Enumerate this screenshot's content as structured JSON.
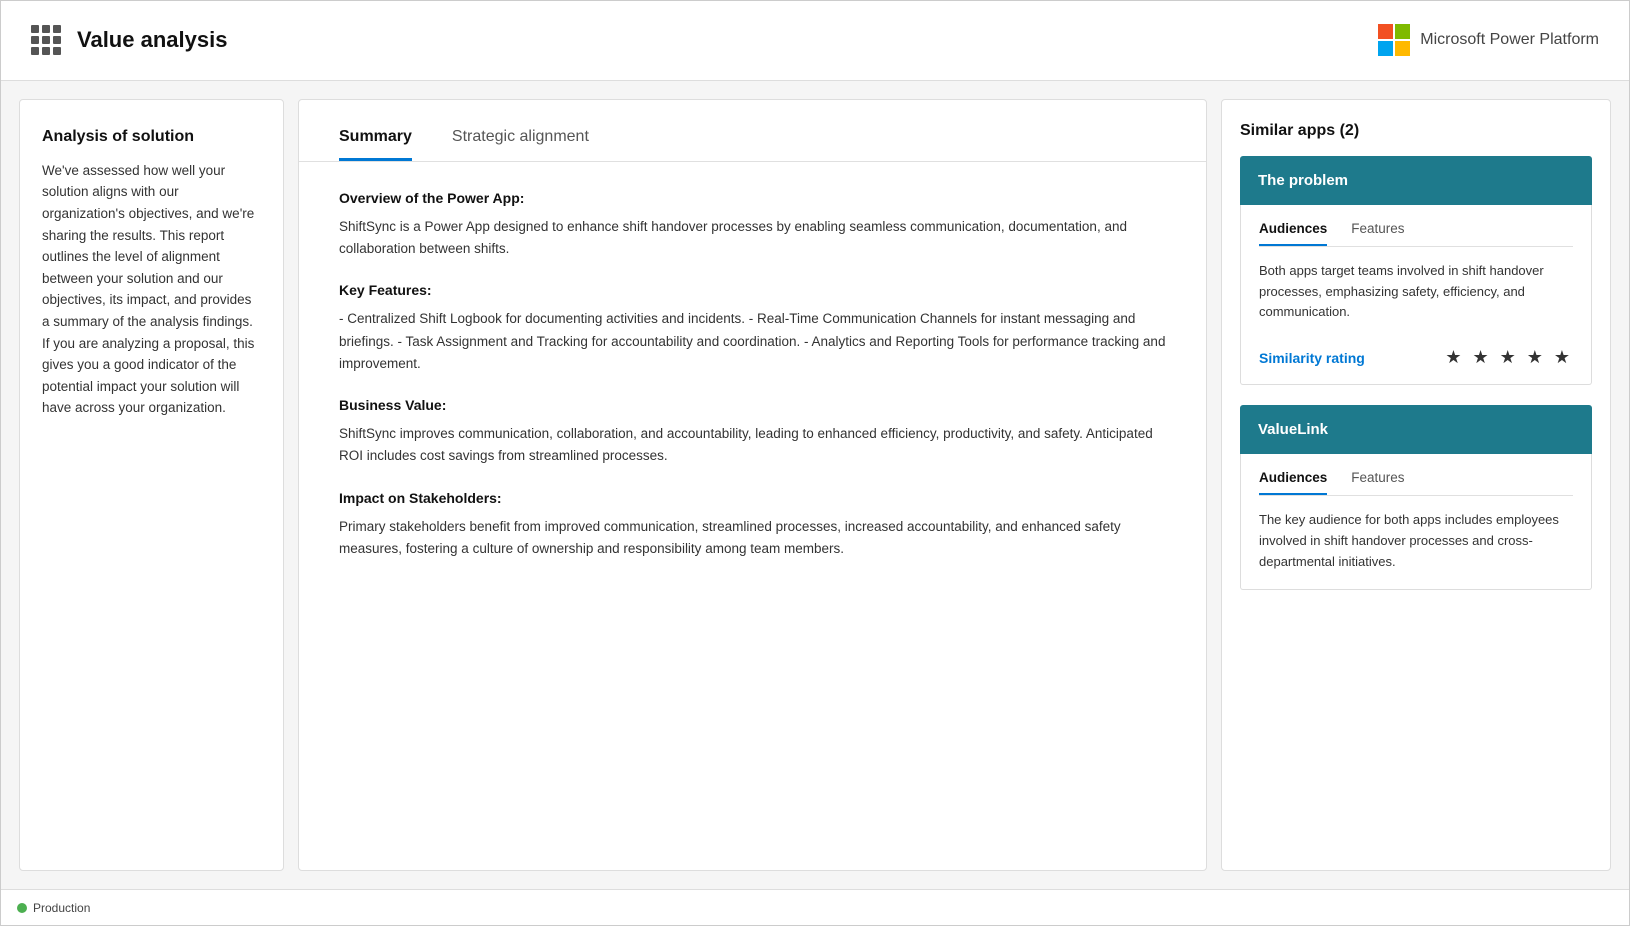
{
  "header": {
    "title": "Value analysis",
    "logo_label": "Microsoft Power Platform"
  },
  "left_panel": {
    "title": "Analysis of solution",
    "description": "We've assessed how well your solution aligns with our organization's objectives, and we're sharing the results. This report outlines the level of alignment between your solution and our objectives, its impact, and provides a summary of the analysis findings. If you are analyzing a proposal, this gives you a good indicator of the potential impact your solution will have across your organization."
  },
  "center_panel": {
    "tabs": [
      {
        "label": "Summary",
        "active": true
      },
      {
        "label": "Strategic alignment",
        "active": false
      }
    ],
    "summary": {
      "sections": [
        {
          "title": "Overview of the Power App:",
          "text": "ShiftSync is a Power App designed to enhance shift handover processes by enabling seamless communication, documentation, and collaboration between shifts."
        },
        {
          "title": "Key Features:",
          "text": "- Centralized Shift Logbook for documenting activities and incidents. - Real-Time Communication Channels for instant messaging and briefings. - Task Assignment and Tracking for accountability and coordination. - Analytics and Reporting Tools for performance tracking and improvement."
        },
        {
          "title": "Business Value:",
          "text": "ShiftSync improves communication, collaboration, and accountability, leading to enhanced efficiency, productivity, and safety. Anticipated ROI includes cost savings from streamlined processes."
        },
        {
          "title": "Impact on Stakeholders:",
          "text": "Primary stakeholders benefit from improved communication, streamlined processes, increased accountability, and enhanced safety measures, fostering a culture of ownership and responsibility among team members."
        }
      ]
    }
  },
  "right_panel": {
    "title": "Similar apps (2)",
    "apps": [
      {
        "name": "The problem",
        "tabs": [
          "Audiences",
          "Features"
        ],
        "active_tab": "Audiences",
        "audiences_text": "Both apps target teams involved in shift handover processes, emphasizing safety, efficiency, and communication.",
        "features_text": "",
        "similarity_label": "Similarity rating",
        "stars": "★ ★ ★ ★ ★"
      },
      {
        "name": "ValueLink",
        "tabs": [
          "Audiences",
          "Features"
        ],
        "active_tab": "Audiences",
        "audiences_text": "The key audience for both apps includes employees involved in shift handover processes and cross-departmental initiatives.",
        "features_text": "",
        "similarity_label": "",
        "stars": ""
      }
    ]
  },
  "status_bar": {
    "label": "Production"
  }
}
